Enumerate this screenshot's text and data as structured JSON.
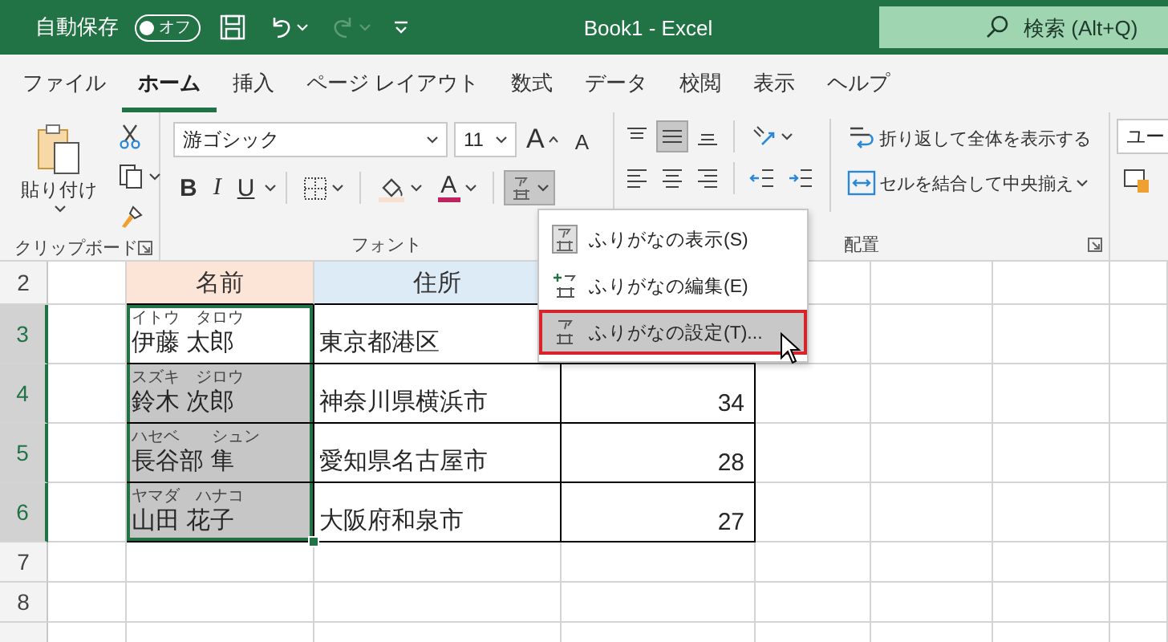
{
  "title_bar": {
    "autosave_label": "自動保存",
    "autosave": {
      "on": false,
      "label": "オフ"
    },
    "quick_access": [
      {
        "kind": "save",
        "disabled": false
      },
      {
        "kind": "undo",
        "disabled": false
      },
      {
        "kind": "redo",
        "disabled": true
      },
      {
        "kind": "customize",
        "disabled": false
      }
    ],
    "title": "Book1 - Excel",
    "search": {
      "placeholder": "検索 (Alt+Q)"
    }
  },
  "tabs": [
    {
      "label": "ファイル",
      "selected": false
    },
    {
      "label": "ホーム",
      "selected": true
    },
    {
      "label": "挿入",
      "selected": false
    },
    {
      "label": "ページ レイアウト",
      "selected": false
    },
    {
      "label": "数式",
      "selected": false
    },
    {
      "label": "データ",
      "selected": false
    },
    {
      "label": "校閲",
      "selected": false
    },
    {
      "label": "表示",
      "selected": false
    },
    {
      "label": "ヘルプ",
      "selected": false
    }
  ],
  "ribbon": {
    "clipboard": {
      "paste_label": "貼り付け",
      "group_label": "クリップボード"
    },
    "font": {
      "font_name": "游ゴシック",
      "font_size": "11",
      "size_buttons": [
        {
          "kind": "grow",
          "label": "A"
        },
        {
          "kind": "shrink",
          "label": "A"
        }
      ],
      "buttons": [
        {
          "kind": "bold",
          "label": "B",
          "pressed": false
        },
        {
          "kind": "italic",
          "label": "I",
          "pressed": false
        },
        {
          "kind": "underline",
          "label": "U",
          "pressed": false
        },
        {
          "kind": "borders",
          "pressed": false
        },
        {
          "kind": "fill_color",
          "pressed": false
        },
        {
          "kind": "font_color",
          "label": "A",
          "pressed": false
        },
        {
          "kind": "furigana",
          "pressed": true
        }
      ],
      "group_label": "フォント"
    },
    "alignment": {
      "top_buttons": [
        {
          "kind": "align_top",
          "pressed": false
        },
        {
          "kind": "align_middle",
          "pressed": true
        },
        {
          "kind": "align_bottom",
          "pressed": false
        },
        {
          "kind": "orientation",
          "pressed": false
        }
      ],
      "bottom_buttons": [
        {
          "kind": "align_left",
          "pressed": false
        },
        {
          "kind": "align_center",
          "pressed": false
        },
        {
          "kind": "align_right",
          "pressed": false
        },
        {
          "kind": "indent_decrease",
          "pressed": false
        },
        {
          "kind": "indent_increase",
          "pressed": false
        }
      ],
      "wrap_text": "折り返して全体を表示する",
      "merge_center": "セルを結合して中央揃え",
      "group_label": "配置"
    },
    "number": {
      "format": "ユー"
    }
  },
  "furigana_menu": {
    "items": [
      {
        "kind": "show",
        "label": "ふりがなの表示(S)",
        "selected": false
      },
      {
        "kind": "edit",
        "label": "ふりがなの編集(E)",
        "selected": false
      },
      {
        "kind": "settings",
        "label": "ふりがなの設定(T)...",
        "selected": true
      }
    ]
  },
  "sheet": {
    "rows": [
      {
        "header": "2",
        "selected": false,
        "cells": [
          {
            "kind": "header",
            "text": "名前",
            "color": "#fce4d6"
          },
          {
            "kind": "header",
            "text": "住所",
            "color": "#ddebf7"
          }
        ]
      },
      {
        "header": "3",
        "selected": true,
        "cells": [
          {
            "kind": "name",
            "furigana": "イトウ　タロウ",
            "text": "伊藤 太郎",
            "selected": true,
            "active": true
          },
          {
            "kind": "address",
            "text": "東京都港区"
          },
          {
            "kind": "count"
          }
        ]
      },
      {
        "header": "4",
        "selected": true,
        "cells": [
          {
            "kind": "name",
            "furigana": "スズキ　ジロウ",
            "text": "鈴木 次郎",
            "selected": true,
            "active": false
          },
          {
            "kind": "address",
            "text": "神奈川県横浜市"
          },
          {
            "kind": "count",
            "text": "34"
          }
        ]
      },
      {
        "header": "5",
        "selected": true,
        "cells": [
          {
            "kind": "name",
            "furigana": "ハセベ　　シュン",
            "text": "長谷部 隼",
            "selected": true,
            "active": false
          },
          {
            "kind": "address",
            "text": "愛知県名古屋市"
          },
          {
            "kind": "count",
            "text": "28"
          }
        ]
      },
      {
        "header": "6",
        "selected": true,
        "cells": [
          {
            "kind": "name",
            "furigana": "ヤマダ　ハナコ",
            "text": "山田 花子",
            "selected": true,
            "active": false
          },
          {
            "kind": "address",
            "text": "大阪府和泉市"
          },
          {
            "kind": "count",
            "text": "27"
          }
        ]
      },
      {
        "header": "7",
        "selected": false,
        "cells": []
      },
      {
        "header": "8",
        "selected": false,
        "cells": []
      }
    ]
  }
}
